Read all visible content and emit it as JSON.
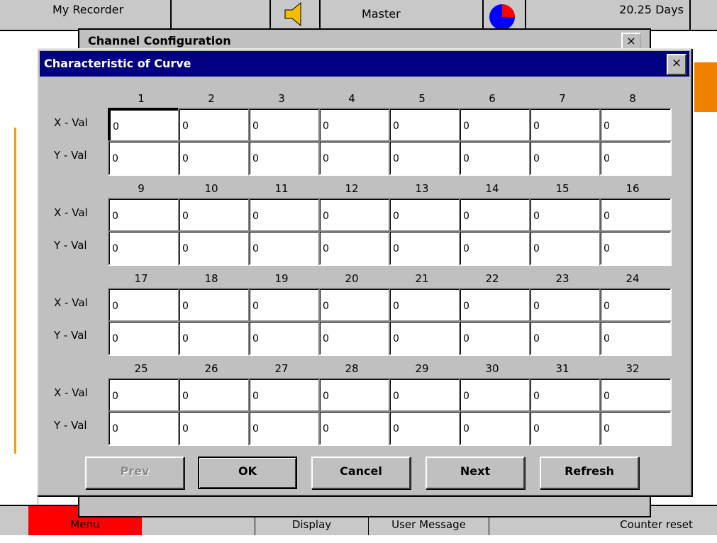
{
  "status_bar": {
    "recorder_name": "My Recorder",
    "mode": "Master",
    "days": "20.25 Days"
  },
  "back_dialog": {
    "title": "Channel Configuration",
    "close_label": "×"
  },
  "dialog": {
    "title": "Characteristic of Curve",
    "close_label": "×",
    "x_label": "X - Val",
    "y_label": "Y - Val",
    "groups": [
      {
        "headers": [
          "1",
          "2",
          "3",
          "4",
          "5",
          "6",
          "7",
          "8"
        ],
        "x_values": [
          "0",
          "0",
          "0",
          "0",
          "0",
          "0",
          "0",
          "0"
        ],
        "y_values": [
          "0",
          "0",
          "0",
          "0",
          "0",
          "0",
          "0",
          "0"
        ]
      },
      {
        "headers": [
          "9",
          "10",
          "11",
          "12",
          "13",
          "14",
          "15",
          "16"
        ],
        "x_values": [
          "0",
          "0",
          "0",
          "0",
          "0",
          "0",
          "0",
          "0"
        ],
        "y_values": [
          "0",
          "0",
          "0",
          "0",
          "0",
          "0",
          "0",
          "0"
        ]
      },
      {
        "headers": [
          "17",
          "18",
          "19",
          "20",
          "21",
          "22",
          "23",
          "24"
        ],
        "x_values": [
          "0",
          "0",
          "0",
          "0",
          "0",
          "0",
          "0",
          "0"
        ],
        "y_values": [
          "0",
          "0",
          "0",
          "0",
          "0",
          "0",
          "0",
          "0"
        ]
      },
      {
        "headers": [
          "25",
          "26",
          "27",
          "28",
          "29",
          "30",
          "31",
          "32"
        ],
        "x_values": [
          "0",
          "0",
          "0",
          "0",
          "0",
          "0",
          "0",
          "0"
        ],
        "y_values": [
          "0",
          "0",
          "0",
          "0",
          "0",
          "0",
          "0",
          "0"
        ]
      }
    ],
    "buttons": {
      "prev": "Prev",
      "ok": "OK",
      "cancel": "Cancel",
      "next": "Next",
      "refresh": "Refresh"
    }
  },
  "bottom_bar": {
    "menu": "Menu",
    "display": "Display",
    "user_message": "User Message",
    "counter_reset": "Counter reset"
  },
  "colors": {
    "titlebar": "#000080",
    "dialog_face": "#c0c0c0",
    "menu_button": "#ff0000",
    "accent_orange": "#f0a000"
  }
}
